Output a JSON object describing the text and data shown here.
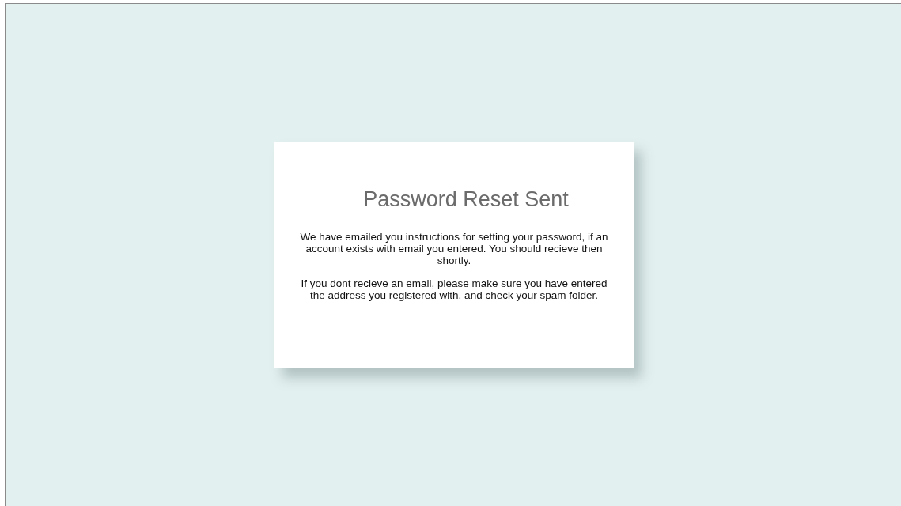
{
  "card": {
    "title": "Password Reset Sent",
    "paragraphs": [
      "We have emailed you instructions for setting your password, if an account exists with email you entered. You should recieve then shortly.",
      "If you dont recieve an email, please make sure you have entered the address you registered with, and check your spam folder."
    ]
  }
}
